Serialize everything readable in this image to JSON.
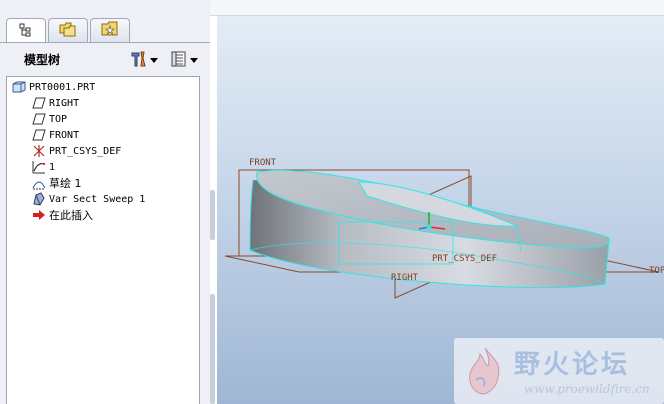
{
  "tabs": [
    {
      "icon": "model-tree-icon",
      "active": true
    },
    {
      "icon": "folder-browser-icon",
      "active": false
    },
    {
      "icon": "favorites-icon",
      "active": false
    }
  ],
  "model_tree": {
    "title": "模型树",
    "settings_icon": "tree-settings-icon",
    "columns_icon": "tree-columns-icon",
    "items": [
      {
        "label": "PRT0001.PRT",
        "icon": "part-icon"
      },
      {
        "label": "RIGHT",
        "icon": "datum-plane-icon"
      },
      {
        "label": "TOP",
        "icon": "datum-plane-icon"
      },
      {
        "label": "FRONT",
        "icon": "datum-plane-icon"
      },
      {
        "label": "PRT_CSYS_DEF",
        "icon": "coordinate-system-icon"
      },
      {
        "label": "1",
        "icon": "datum-curve-icon"
      },
      {
        "label": "草绘 1",
        "icon": "sketch-icon"
      },
      {
        "label": "Var Sect Sweep 1",
        "icon": "sweep-icon"
      },
      {
        "label": "在此插入",
        "icon": "insert-arrow-icon"
      }
    ]
  },
  "viewport": {
    "labels": {
      "front": "FRONT",
      "top": "TOP",
      "right": "RIGHT",
      "csys": "PRT_CSYS_DEF"
    },
    "colors": {
      "datum": "#8a4a2a",
      "edge_highlight": "#2ee6e6",
      "background_top": "#e4ecf6",
      "background_bottom": "#9fb6d4"
    }
  },
  "watermark": {
    "title": "野火论坛",
    "url": "www.proewildfire.cn"
  }
}
